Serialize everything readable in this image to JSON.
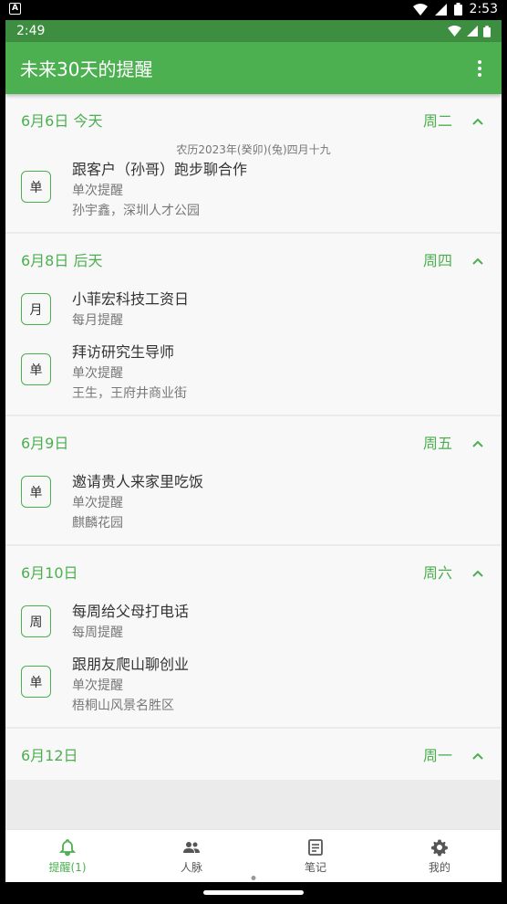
{
  "outer_status": {
    "badge": "A",
    "time": "2:53"
  },
  "inner_status": {
    "time": "2:49"
  },
  "appbar": {
    "title": "未来30天的提醒",
    "menu_icon": "more-vert-icon"
  },
  "sections": [
    {
      "date": "6月6日  今天",
      "weekday": "周二",
      "lunar": "农历2023年(癸卯)(兔)四月十九",
      "items": [
        {
          "badge": "单",
          "title": "跟客户（孙哥）跑步聊合作",
          "type": "单次提醒",
          "location": "孙宇鑫，深圳人才公园"
        }
      ]
    },
    {
      "date": "6月8日  后天",
      "weekday": "周四",
      "items": [
        {
          "badge": "月",
          "title": "小菲宏科技工资日",
          "type": "每月提醒"
        },
        {
          "badge": "单",
          "title": "拜访研究生导师",
          "type": "单次提醒",
          "location": "王生，王府井商业街"
        }
      ]
    },
    {
      "date": "6月9日",
      "weekday": "周五",
      "items": [
        {
          "badge": "单",
          "title": "邀请贵人来家里吃饭",
          "type": "单次提醒",
          "location": "麒麟花园"
        }
      ]
    },
    {
      "date": "6月10日",
      "weekday": "周六",
      "items": [
        {
          "badge": "周",
          "title": "每周给父母打电话",
          "type": "每周提醒"
        },
        {
          "badge": "单",
          "title": "跟朋友爬山聊创业",
          "type": "单次提醒",
          "location": "梧桐山风景名胜区"
        }
      ]
    },
    {
      "date": "6月12日",
      "weekday": "周一",
      "items": []
    }
  ],
  "tabs": [
    {
      "label": "提醒(1)",
      "icon": "bell-icon",
      "active": true
    },
    {
      "label": "人脉",
      "icon": "people-icon",
      "active": false
    },
    {
      "label": "笔记",
      "icon": "note-icon",
      "active": false
    },
    {
      "label": "我的",
      "icon": "gear-icon",
      "active": false
    }
  ],
  "colors": {
    "primary": "#4caf50",
    "status": "#3e8e41"
  }
}
